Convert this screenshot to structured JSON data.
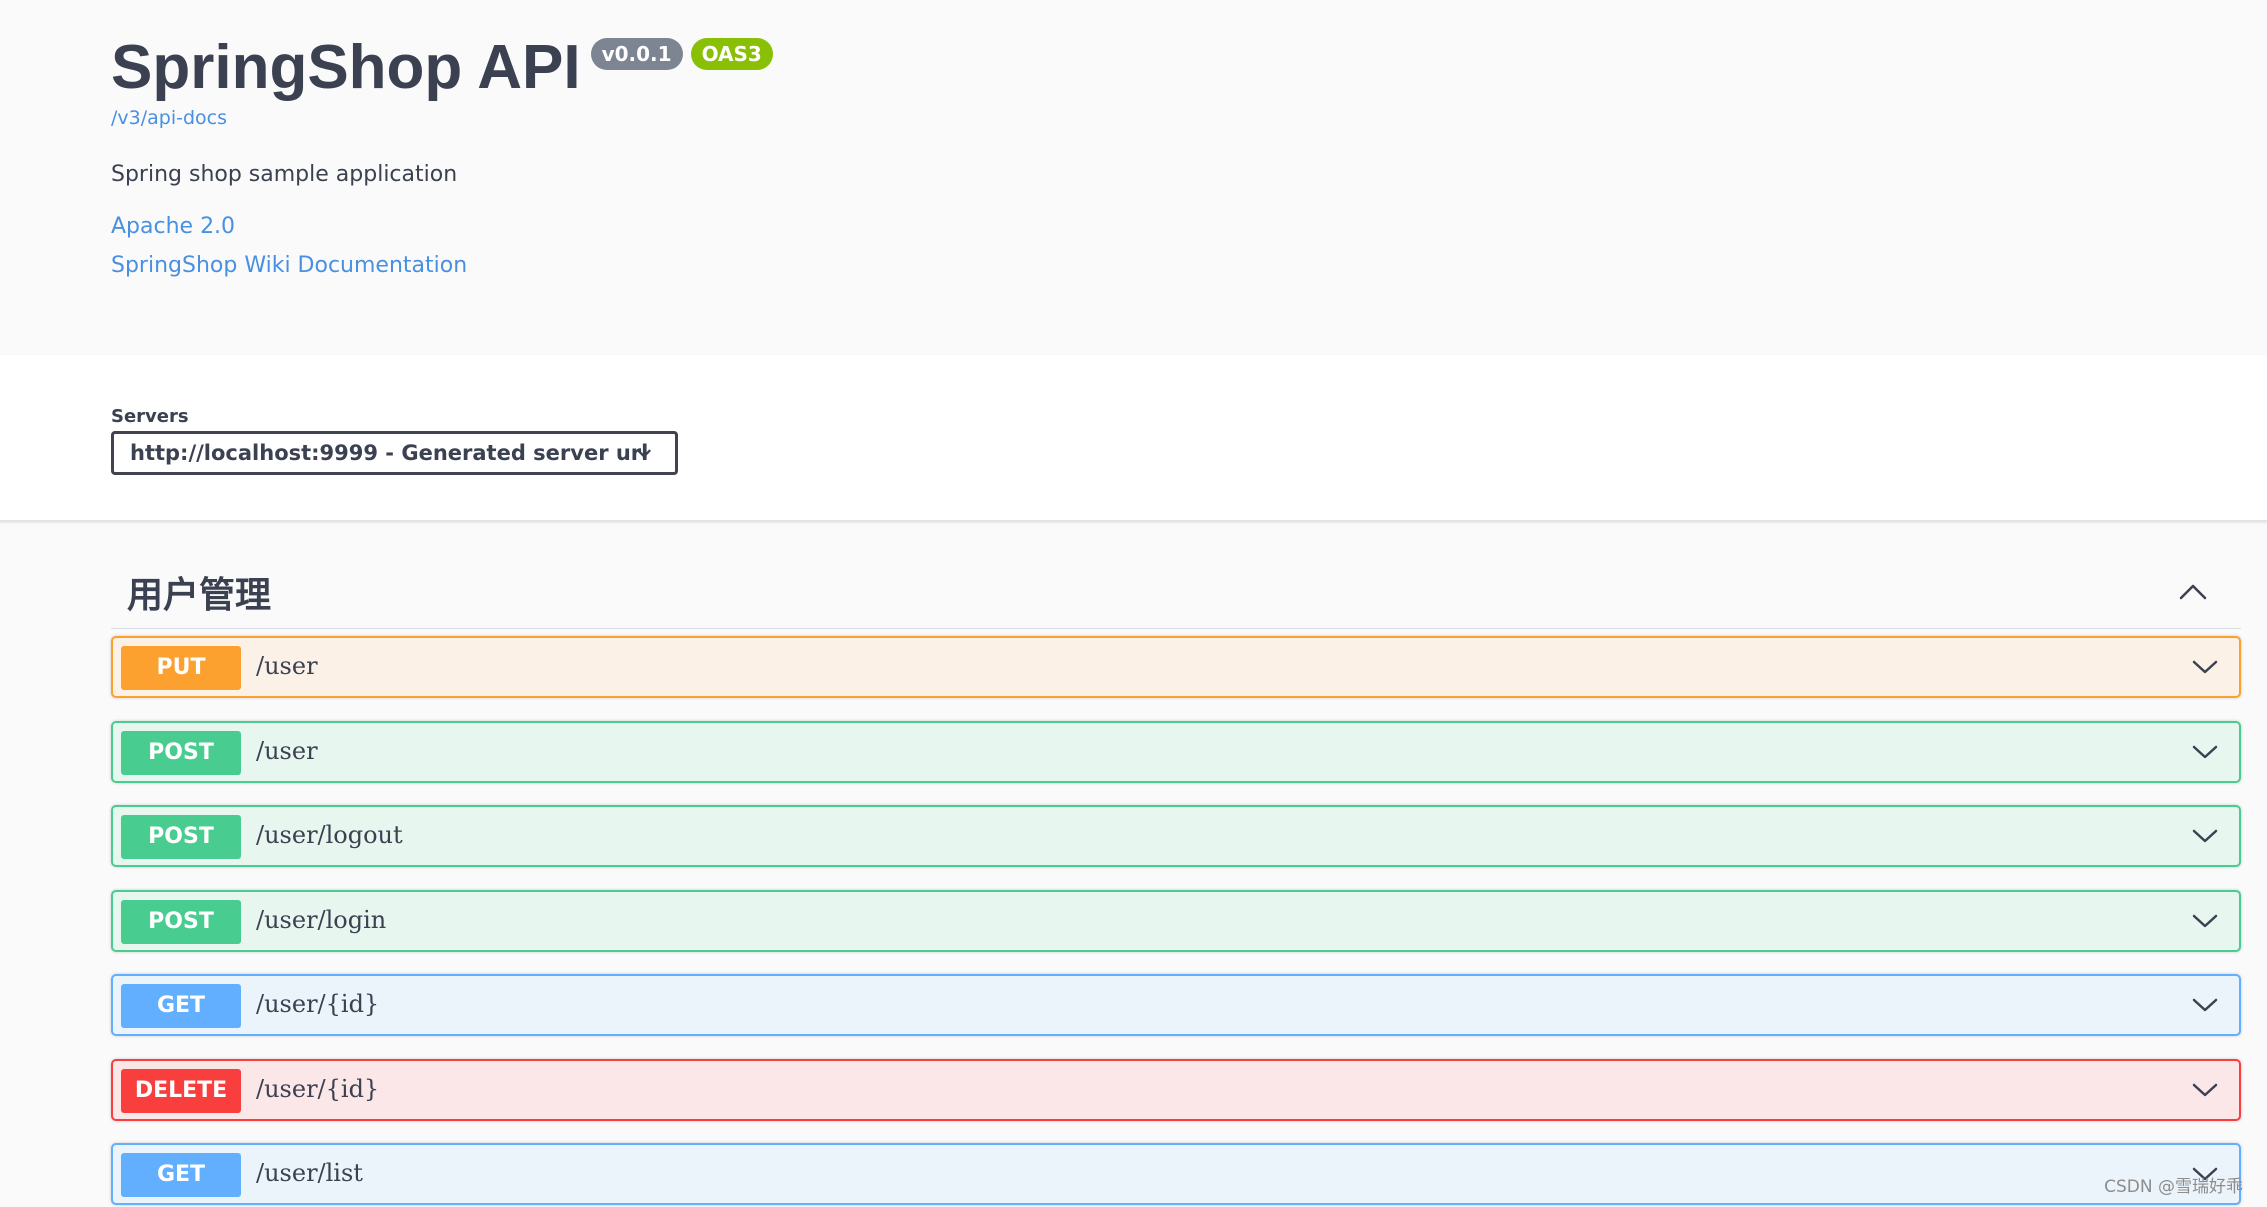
{
  "info": {
    "title": "SpringShop API",
    "version_badge": "v0.0.1",
    "oas_badge": "OAS3",
    "spec_link": "/v3/api-docs",
    "description": "Spring shop sample application",
    "license_link": "Apache 2.0",
    "docs_link": "SpringShop Wiki Documentation"
  },
  "servers": {
    "label": "Servers",
    "selected": "http://localhost:9999 - Generated server url"
  },
  "tag": {
    "title": "用户管理",
    "expanded": true
  },
  "operations": [
    {
      "method": "PUT",
      "path": "/user"
    },
    {
      "method": "POST",
      "path": "/user"
    },
    {
      "method": "POST",
      "path": "/user/logout"
    },
    {
      "method": "POST",
      "path": "/user/login"
    },
    {
      "method": "GET",
      "path": "/user/{id}"
    },
    {
      "method": "DELETE",
      "path": "/user/{id}"
    },
    {
      "method": "GET",
      "path": "/user/list"
    }
  ],
  "colors": {
    "put": "#fca130",
    "post": "#49cc90",
    "get": "#61affe",
    "delete": "#f93e3e",
    "link": "#4990e2",
    "text": "#3b4151"
  },
  "icons": {
    "server_select": "chevron-down-icon",
    "tag_toggle": "chevron-up-icon",
    "operation_toggle": "chevron-down-icon"
  },
  "watermark": "CSDN @雪瑞好乖"
}
